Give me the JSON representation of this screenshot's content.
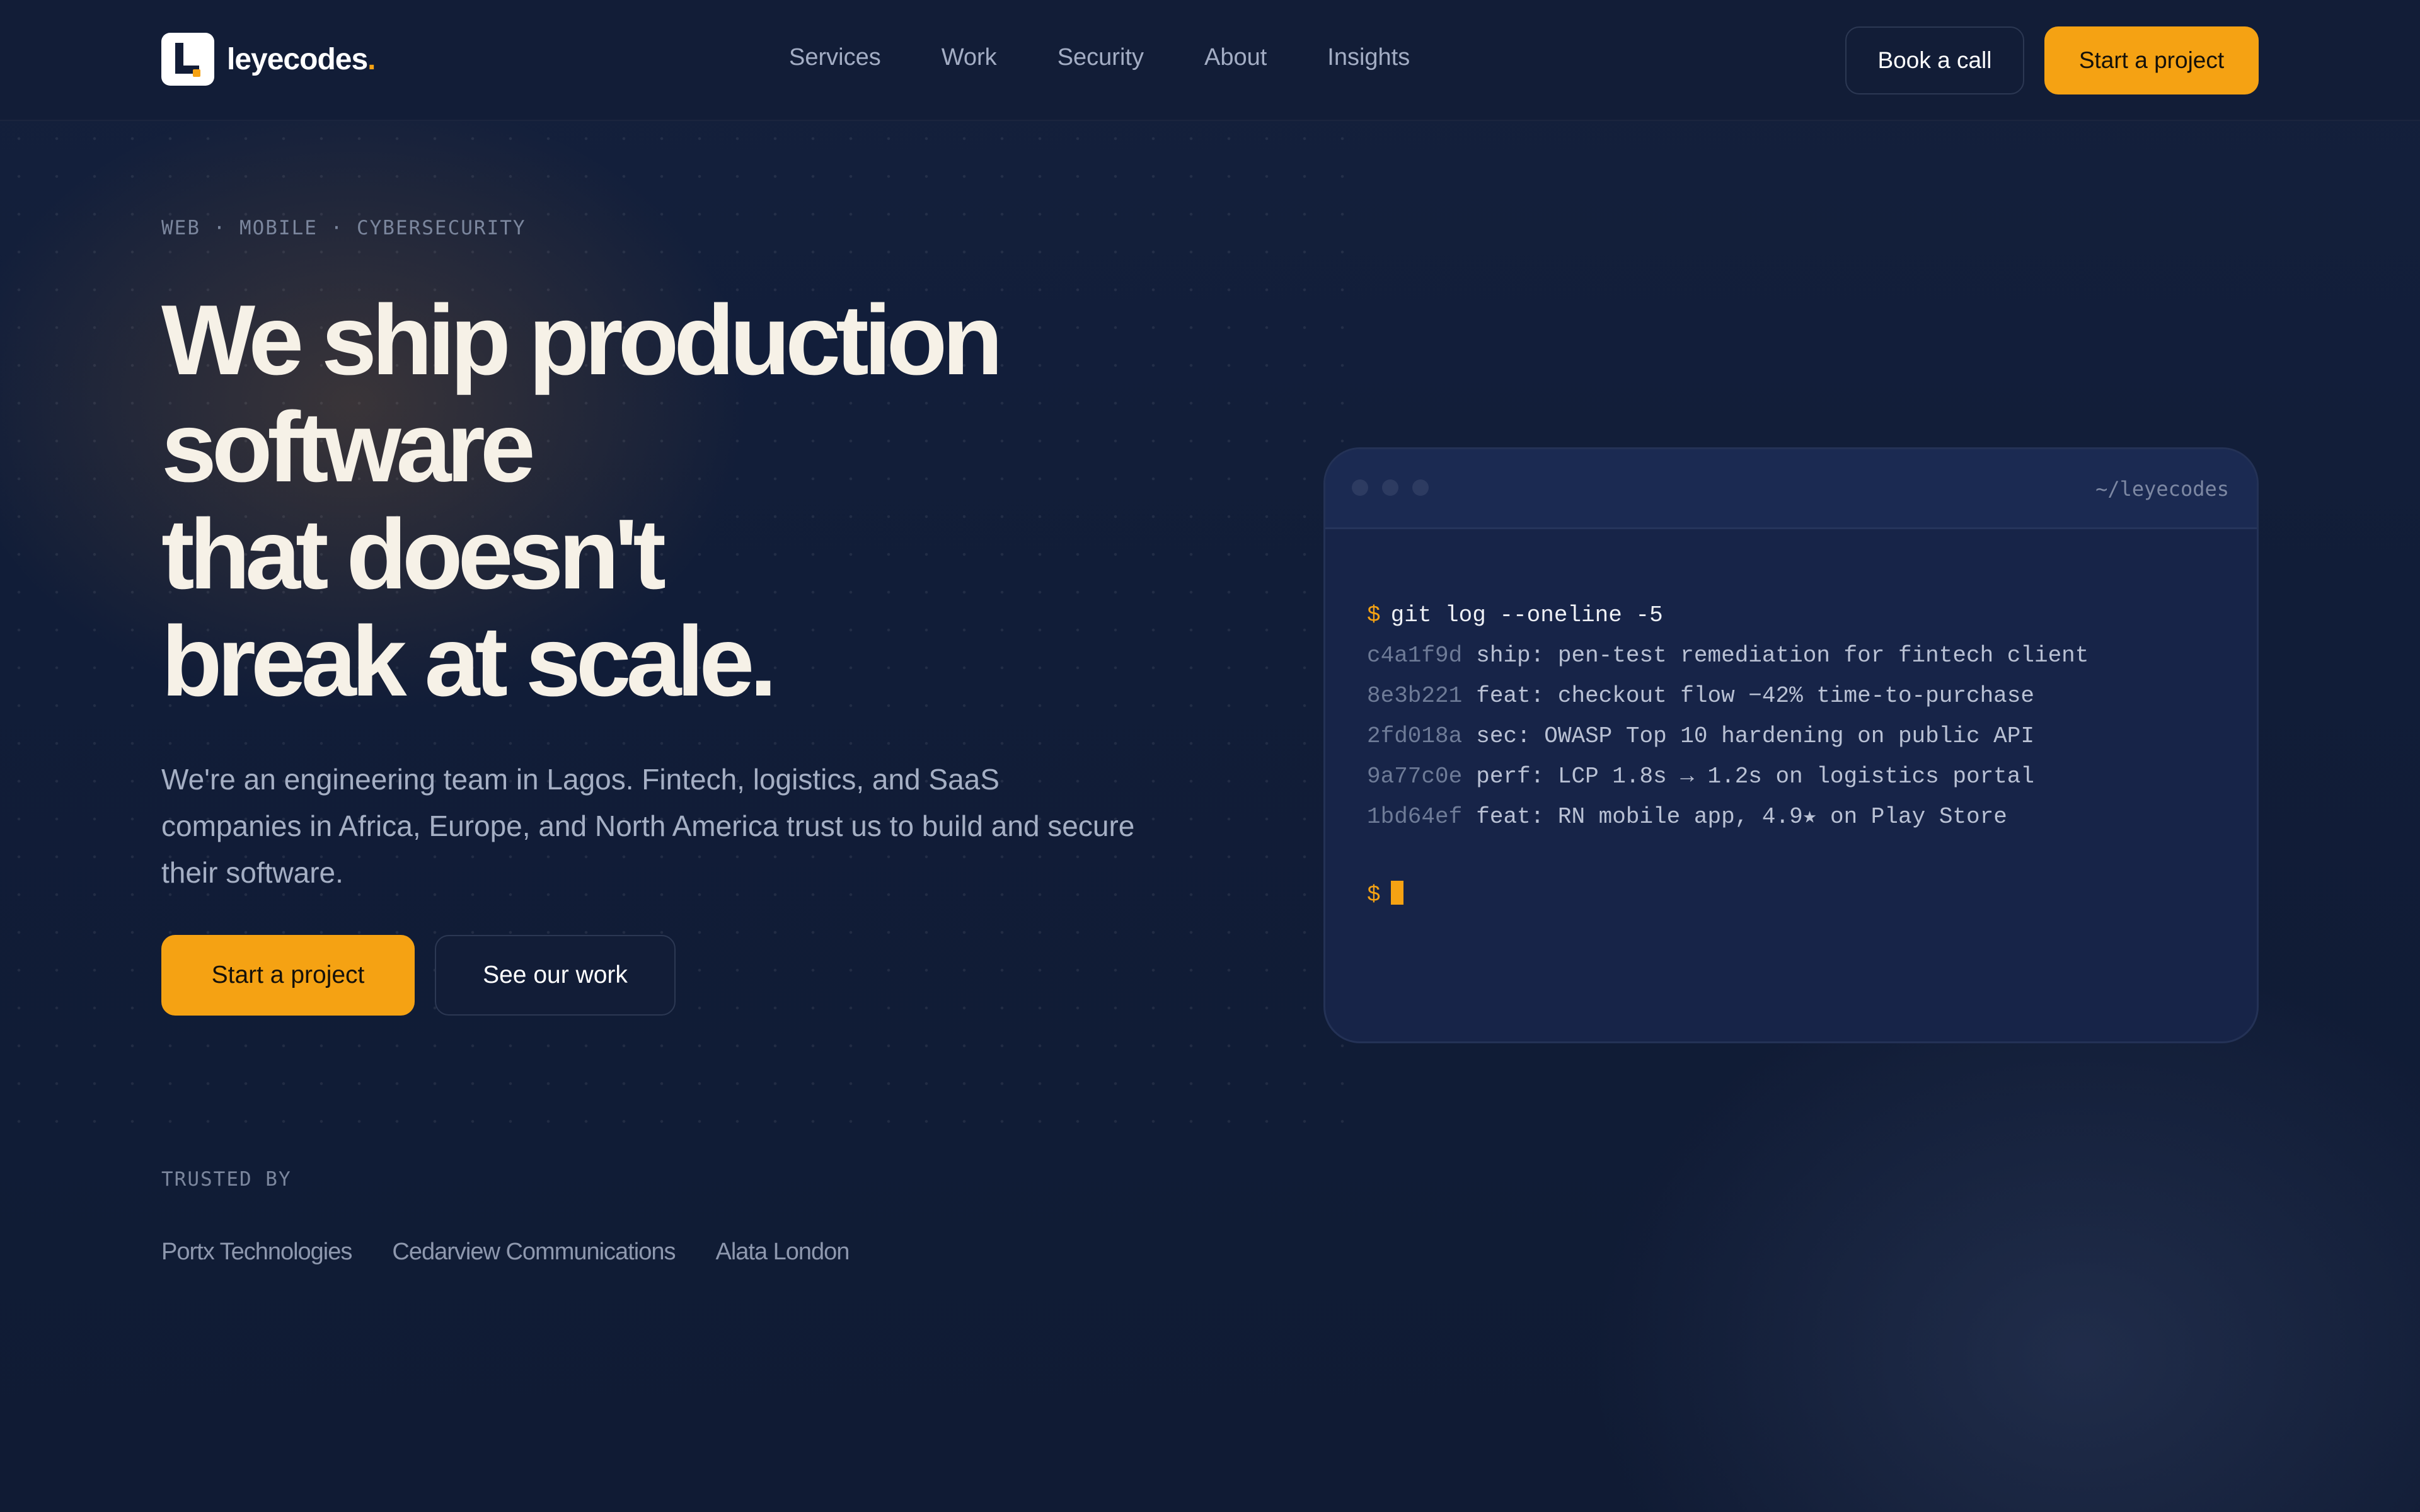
{
  "brand": {
    "name": "leyecodes",
    "dot": ".",
    "accent_color": "#f5a213",
    "background_color": "#111c36"
  },
  "nav": {
    "items": [
      "Services",
      "Work",
      "Security",
      "About",
      "Insights"
    ]
  },
  "header_actions": {
    "book_call": "Book a call",
    "start_project": "Start a project"
  },
  "hero": {
    "eyebrow": "WEB · MOBILE · CYBERSECURITY",
    "headline_lines": [
      "We ship production",
      "software",
      "that doesn't",
      "break at scale."
    ],
    "subtext": "We're an engineering team in Lagos. Fintech, logistics, and SaaS companies in Africa, Europe, and North America trust us to build and secure their software.",
    "primary_cta": "Start a project",
    "secondary_cta": "See our work"
  },
  "terminal": {
    "path": "~/leyecodes",
    "prompt": "$",
    "command": "git log --oneline -5",
    "commits": [
      {
        "hash": "c4a1f9d",
        "message": "ship: pen-test remediation for fintech client"
      },
      {
        "hash": "8e3b221",
        "message": "feat: checkout flow −42% time-to-purchase"
      },
      {
        "hash": "2fd018a",
        "message": "sec: OWASP Top 10 hardening on public API"
      },
      {
        "hash": "9a77c0e",
        "message": "perf: LCP 1.8s → 1.2s on logistics portal"
      },
      {
        "hash": "1bd64ef",
        "message": "feat: RN mobile app, 4.9★ on Play Store"
      }
    ]
  },
  "trusted": {
    "label": "TRUSTED BY",
    "companies": [
      "Portx Technologies",
      "Cedarview Communications",
      "Alata London"
    ]
  }
}
